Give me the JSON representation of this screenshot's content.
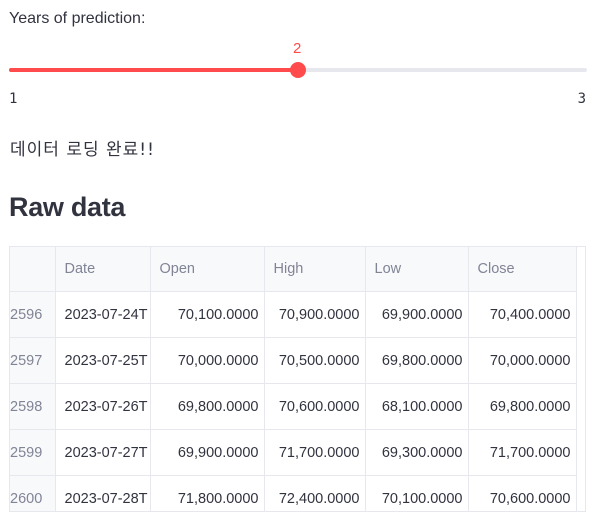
{
  "slider": {
    "label": "Years of prediction:",
    "value": 2,
    "value_label": "2",
    "min": 1,
    "max": 3,
    "min_label": "1",
    "max_label": "3",
    "accent_color": "#ff4b4b"
  },
  "status": {
    "text": "데이터 로딩 완료!!"
  },
  "section": {
    "title": "Raw data"
  },
  "table": {
    "columns": [
      "",
      "Date",
      "Open",
      "High",
      "Low",
      "Close"
    ],
    "rows": [
      {
        "index": "2596",
        "date": "2023-07-24T",
        "open": "70,100.0000",
        "high": "70,900.0000",
        "low": "69,900.0000",
        "close": "70,400.0000"
      },
      {
        "index": "2597",
        "date": "2023-07-25T",
        "open": "70,000.0000",
        "high": "70,500.0000",
        "low": "69,800.0000",
        "close": "70,000.0000"
      },
      {
        "index": "2598",
        "date": "2023-07-26T",
        "open": "69,800.0000",
        "high": "70,600.0000",
        "low": "68,100.0000",
        "close": "69,800.0000"
      },
      {
        "index": "2599",
        "date": "2023-07-27T",
        "open": "69,900.0000",
        "high": "71,700.0000",
        "low": "69,300.0000",
        "close": "71,700.0000"
      },
      {
        "index": "2600",
        "date": "2023-07-28T",
        "open": "71,800.0000",
        "high": "72,400.0000",
        "low": "70,100.0000",
        "close": "70,600.0000"
      }
    ]
  }
}
